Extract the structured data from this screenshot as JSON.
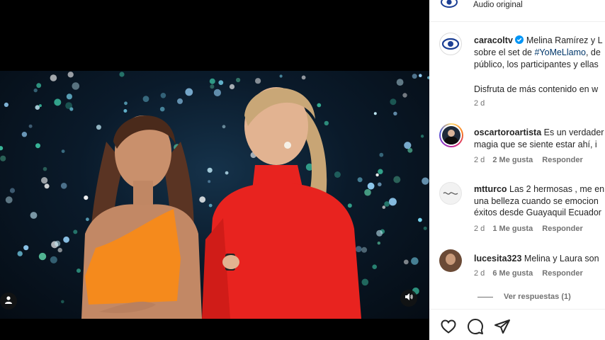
{
  "post_header": {
    "subtitle": "Audio original"
  },
  "caption": {
    "username": "caracoltv",
    "line1_pre": "Melina Ramírez y L",
    "line2_pre": "sobre el set de ",
    "line2_tag": "#YoMeLlamo",
    "line2_post": ", de",
    "line3": "público, los participantes y ellas",
    "line4": "Disfruta de más contenido en w",
    "age": "2 d"
  },
  "comments": [
    {
      "username": "oscartoroartista",
      "line1": "Es un verdader",
      "line2": "magia que se siente estar ahí, i",
      "age": "2 d",
      "likes": "2 Me gusta",
      "reply": "Responder"
    },
    {
      "username": "mtturco",
      "line1": "Las 2 hermosas , me en",
      "line2": "una belleza cuando se emocion",
      "line3": "éxitos desde Guayaquil Ecuador",
      "age": "2 d",
      "likes": "1 Me gusta",
      "reply": "Responder"
    },
    {
      "username": "lucesita323",
      "line1": "Melina y Laura son",
      "age": "2 d",
      "likes": "6 Me gusta",
      "reply": "Responder",
      "view_replies": "Ver respuestas (1)"
    }
  ],
  "icons": {
    "user": "user-icon",
    "mute": "speaker-icon",
    "like": "heart-icon",
    "comment": "comment-icon",
    "share": "share-icon",
    "verified": "verified-badge-icon"
  },
  "colors": {
    "verified": "#0095f6",
    "link": "#00376b",
    "dress_red": "#e8231f",
    "dress_orange": "#f58a1c"
  }
}
